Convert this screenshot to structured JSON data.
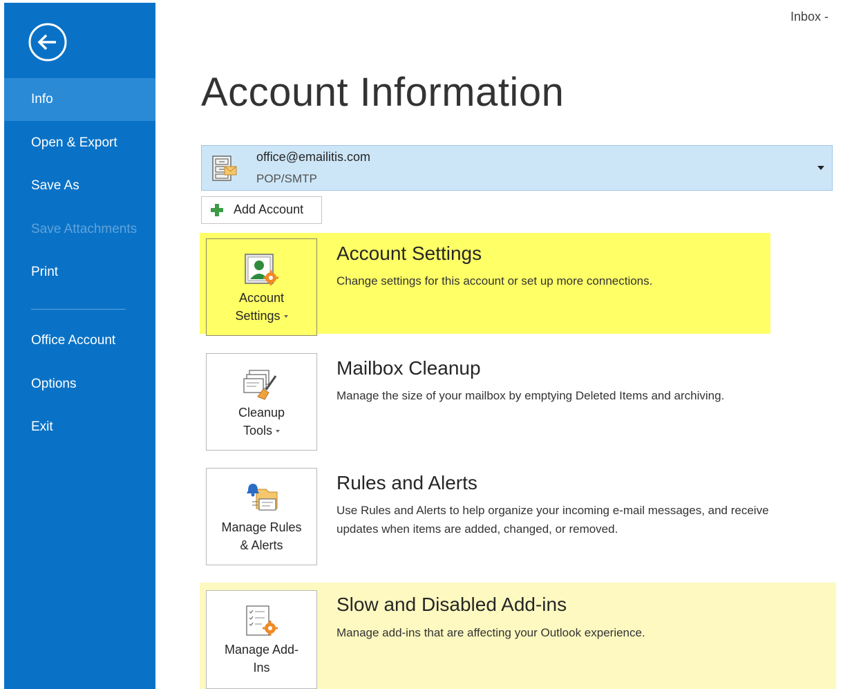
{
  "window": {
    "caption": "Inbox -"
  },
  "sidebar": {
    "back_icon": "back-arrow-icon",
    "items": [
      {
        "label": "Info",
        "state": "active"
      },
      {
        "label": "Open & Export",
        "state": "normal"
      },
      {
        "label": "Save As",
        "state": "normal"
      },
      {
        "label": "Save Attachments",
        "state": "disabled"
      },
      {
        "label": "Print",
        "state": "normal"
      },
      {
        "label": "Office Account",
        "state": "normal"
      },
      {
        "label": "Options",
        "state": "normal"
      },
      {
        "label": "Exit",
        "state": "normal"
      }
    ]
  },
  "main": {
    "title": "Account Information",
    "account": {
      "email": "office@emailitis.com",
      "type": "POP/SMTP",
      "icon": "mail-server-icon"
    },
    "add_account": {
      "label": "Add Account",
      "icon": "plus-icon"
    },
    "sections": [
      {
        "tile_label_line1": "Account",
        "tile_label_line2": "Settings",
        "tile_icon": "account-settings-icon",
        "title": "Account Settings",
        "description": "Change settings for this account or set up more connections."
      },
      {
        "tile_label_line1": "Cleanup",
        "tile_label_line2": "Tools",
        "tile_icon": "cleanup-tools-icon",
        "title": "Mailbox Cleanup",
        "description": "Manage the size of your mailbox by emptying Deleted Items and archiving."
      },
      {
        "tile_label_line1": "Manage Rules",
        "tile_label_line2": "& Alerts",
        "tile_icon": "rules-alerts-icon",
        "title": "Rules and Alerts",
        "description_line1": "Use Rules and Alerts to help organize your incoming e-mail messages, and receive",
        "description_line2": "updates when items are added, changed, or removed."
      },
      {
        "tile_label_line1": "Manage Add-",
        "tile_label_line2": "Ins",
        "tile_icon": "addins-icon",
        "title": "Slow and Disabled Add-ins",
        "description": "Manage add-ins that are affecting your Outlook experience."
      }
    ]
  },
  "colors": {
    "sidebar": "#0a72c6",
    "sidebar_active": "#2a8ad6",
    "highlight_strong": "#ffff66",
    "highlight_soft": "#fdf9c0",
    "account_bar": "#cde6f7"
  }
}
